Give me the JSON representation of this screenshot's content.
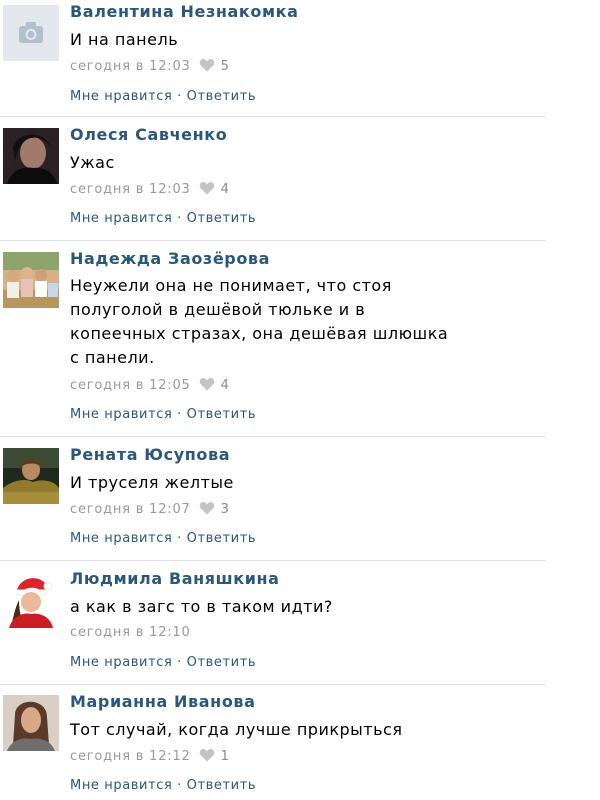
{
  "comments": [
    {
      "author": "Валентина Незнакомка",
      "text": "И на панель",
      "time": "сегодня в 12:03",
      "likes": "5",
      "avatar_icon": "camera-placeholder-icon",
      "like_label": "Мне нравится",
      "separator": " · ",
      "reply_label": "Ответить"
    },
    {
      "author": "Олеся Савченко",
      "text": "Ужас",
      "time": "сегодня в 12:03",
      "likes": "4",
      "avatar_icon": "user-photo",
      "like_label": "Мне нравится",
      "separator": " · ",
      "reply_label": "Ответить"
    },
    {
      "author": "Надежда Заозёрова",
      "text": "Неужели она не понимает, что стоя\nполуголой в дешёвой тюльке и в\nкопеечных стразах, она дешёвая шлюшка\nс панели.",
      "time": "сегодня в 12:05",
      "likes": "4",
      "avatar_icon": "user-photo",
      "like_label": "Мне нравится",
      "separator": " · ",
      "reply_label": "Ответить"
    },
    {
      "author": "Рената Юсупова",
      "text": "И труселя желтые",
      "time": "сегодня в 12:07",
      "likes": "3",
      "avatar_icon": "user-photo",
      "like_label": "Мне нравится",
      "separator": " · ",
      "reply_label": "Ответить"
    },
    {
      "author": "Людмила Ваняшкина",
      "text": "а как в загс то в таком идти?",
      "time": "сегодня в 12:10",
      "likes": "",
      "avatar_icon": "user-photo",
      "like_label": "Мне нравится",
      "separator": " · ",
      "reply_label": "Ответить"
    },
    {
      "author": "Марианна Иванова",
      "text": "Тот случай, когда лучше прикрыться",
      "time": "сегодня в 12:12",
      "likes": "1",
      "avatar_icon": "user-photo",
      "like_label": "Мне нравится",
      "separator": " · ",
      "reply_label": "Ответить"
    }
  ],
  "colors": {
    "link": "#2b587a",
    "meta": "#999999",
    "divider": "#dee3ea"
  }
}
